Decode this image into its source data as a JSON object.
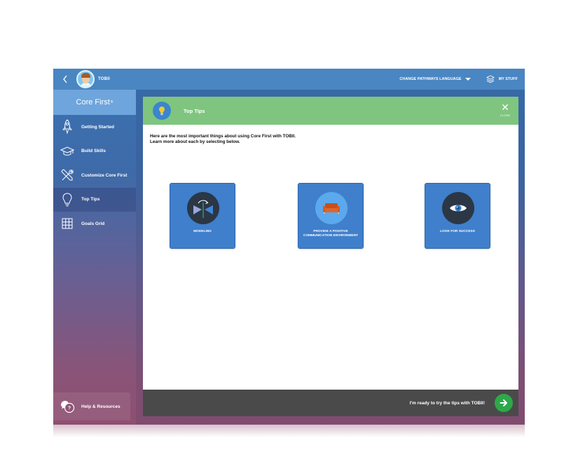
{
  "topbar": {
    "user_name": "TOBII",
    "language_label": "CHANGE PATHWAYS LANGUAGE",
    "my_stuff_label": "MY STUFF"
  },
  "sidebar": {
    "title": "Core First",
    "title_mark": "®",
    "items": [
      {
        "label": "Getting Started",
        "icon": "rocket-icon",
        "active": false
      },
      {
        "label": "Build Skills",
        "icon": "graduation-cap-icon",
        "active": false
      },
      {
        "label": "Customize Core First",
        "icon": "tools-icon",
        "active": false
      },
      {
        "label": "Top Tips",
        "icon": "lightbulb-icon",
        "active": true
      },
      {
        "label": "Goals Grid",
        "icon": "grid-icon",
        "active": false
      }
    ],
    "help_label": "Help & Resources"
  },
  "header": {
    "title": "Top Tips",
    "close_label": "CLOSE"
  },
  "content": {
    "intro_line1": "Here are the most important things about using Core First with TOBII.",
    "intro_line2": "Learn more about each by selecting below.",
    "cards": [
      {
        "label": "MODELING",
        "icon": "modeling-icon"
      },
      {
        "label": "PROVIDE A POSITIVE COMMUNICATION ENVIRONMENT",
        "icon": "sofa-icon"
      },
      {
        "label": "LOOK FOR SUCCESS",
        "icon": "eye-icon"
      }
    ]
  },
  "footer": {
    "text": "I'm ready to try the tips with TOBII!"
  },
  "colors": {
    "header_green": "#7fc57f",
    "card_blue": "#3f7fcc",
    "go_button_green": "#2da94a",
    "footer_gray": "#4a4a4a"
  }
}
